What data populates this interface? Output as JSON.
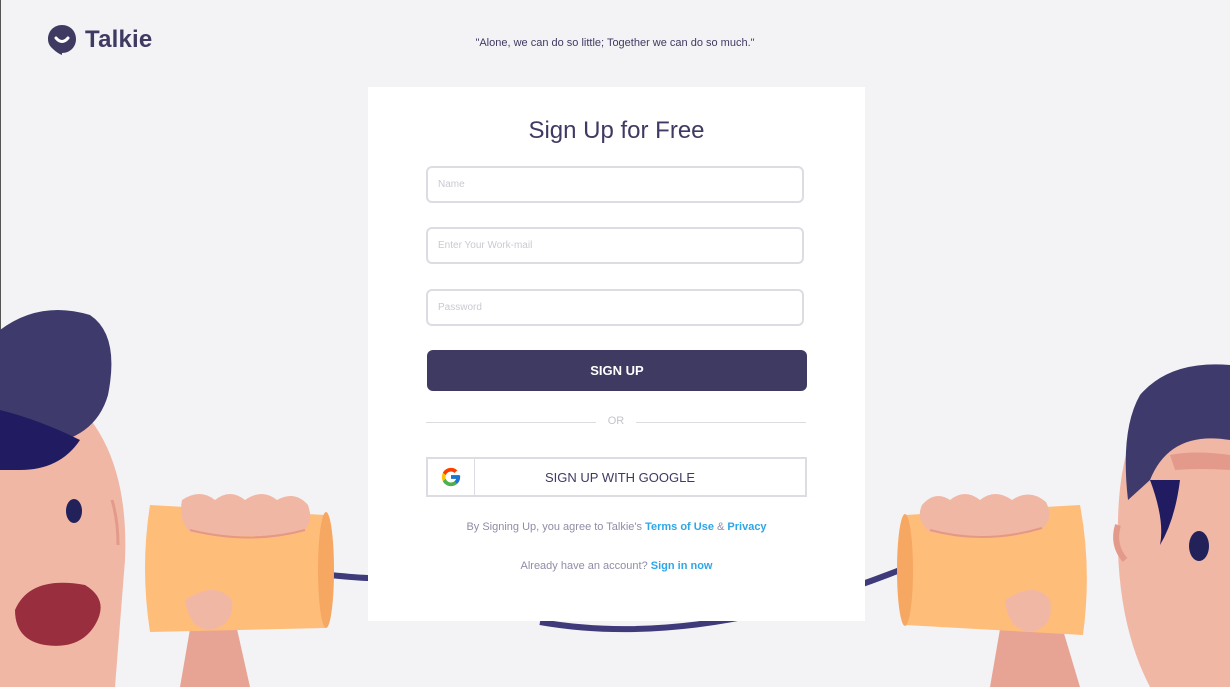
{
  "brand": {
    "name": "Talkie"
  },
  "quote": "\"Alone, we can do so little; Together we can do so much.\"",
  "signup": {
    "title": "Sign Up for Free",
    "name_placeholder": "Name",
    "email_placeholder": "Enter Your Work-mail",
    "password_placeholder": "Password",
    "submit_label": "SIGN UP",
    "or_label": "OR",
    "google_label": "SIGN UP WITH GOOGLE",
    "terms_prefix": "By Signing Up, you agree to Talkie's",
    "terms_link": "Terms of Use",
    "terms_and": "&",
    "privacy_link": "Privacy",
    "signin_prefix": "Already have an account?",
    "signin_link": "Sign in now"
  },
  "colors": {
    "accent": "#3f3a62",
    "link": "#2ea6e8",
    "background": "#f3f3f6"
  }
}
